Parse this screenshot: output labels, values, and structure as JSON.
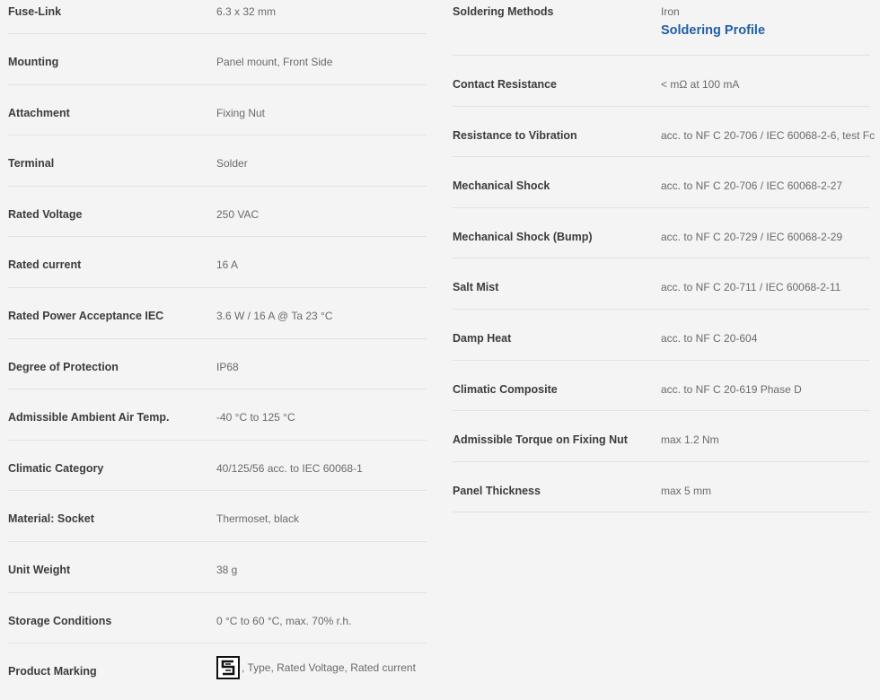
{
  "left_specs": [
    {
      "label": "Fuse-Link",
      "value": "6.3 x 32 mm"
    },
    {
      "label": "Mounting",
      "value": "Panel mount, Front Side"
    },
    {
      "label": "Attachment",
      "value": "Fixing Nut"
    },
    {
      "label": "Terminal",
      "value": "Solder"
    },
    {
      "label": "Rated Voltage",
      "value": "250 VAC"
    },
    {
      "label": "Rated current",
      "value": "16 A"
    },
    {
      "label": "Rated Power Acceptance IEC",
      "value": "3.6 W / 16 A @ Ta 23 °C"
    },
    {
      "label": "Degree of Protection",
      "value": "IP68"
    },
    {
      "label": "Admissible Ambient Air Temp.",
      "value": "-40 °C to 125 °C"
    },
    {
      "label": "Climatic Category",
      "value": "40/125/56 acc. to IEC 60068-1"
    },
    {
      "label": "Material: Socket",
      "value": "Thermoset, black"
    },
    {
      "label": "Unit Weight",
      "value": "38 g"
    },
    {
      "label": "Storage Conditions",
      "value": "0 °C to 60 °C, max. 70% r.h."
    },
    {
      "label": "Product Marking",
      "value": ", Type, Rated Voltage, Rated current",
      "icon": "manufacturer-logo-icon"
    }
  ],
  "right_specs": [
    {
      "label": "Soldering Methods",
      "value": "Iron",
      "link": "Soldering Profile"
    },
    {
      "label": "Contact Resistance",
      "value": "< mΩ at 100 mA"
    },
    {
      "label": "Resistance to Vibration",
      "value": "acc. to NF C 20-706 / IEC 60068-2-6, test Fc"
    },
    {
      "label": "Mechanical Shock",
      "value": "acc. to NF C 20-706 / IEC 60068-2-27"
    },
    {
      "label": "Mechanical Shock (Bump)",
      "value": "acc. to NF C 20-729 / IEC 60068-2-29"
    },
    {
      "label": "Salt Mist",
      "value": "acc. to NF C 20-711 / IEC 60068-2-11"
    },
    {
      "label": "Damp Heat",
      "value": "acc. to NF C 20-604"
    },
    {
      "label": "Climatic Composite",
      "value": "acc. to NF C 20-619 Phase D"
    },
    {
      "label": "Admissible Torque on Fixing Nut",
      "value": "max 1.2 Nm"
    },
    {
      "label": "Panel Thickness",
      "value": "max 5 mm"
    }
  ],
  "colors": {
    "background": "#f4f4f4",
    "label": "#3c3c3c",
    "value": "#6a6a6a",
    "link": "#1f5fa6",
    "divider": "#e2e2e2"
  }
}
